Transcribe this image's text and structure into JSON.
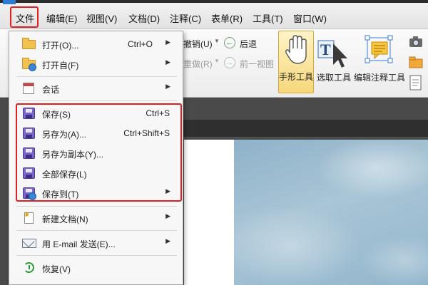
{
  "menubar": {
    "items": [
      "文件",
      "编辑(E)",
      "视图(V)",
      "文档(D)",
      "注释(C)",
      "表单(R)",
      "工具(T)",
      "窗口(W)"
    ]
  },
  "toolbar": {
    "undo": "撤销(U)",
    "back": "后退",
    "redo": "重做(R)",
    "prev_view": "前一视图",
    "hand_tool": "手形工具",
    "select_tool": "选取工具",
    "edit_annot_tool": "编辑注释工具"
  },
  "file_menu": {
    "open": {
      "label": "打开(O)...",
      "shortcut": "Ctrl+O"
    },
    "open_from": {
      "label": "打开自(F)"
    },
    "session": {
      "label": "会话"
    },
    "save": {
      "label": "保存(S)",
      "shortcut": "Ctrl+S"
    },
    "save_as": {
      "label": "另存为(A)...",
      "shortcut": "Ctrl+Shift+S"
    },
    "save_copy": {
      "label": "另存为副本(Y)..."
    },
    "save_all": {
      "label": "全部保存(L)"
    },
    "save_to": {
      "label": "保存到(T)"
    },
    "new_doc": {
      "label": "新建文档(N)"
    },
    "email": {
      "label": "用 E-mail 发送(E)..."
    },
    "restore": {
      "label": "恢复(V)"
    }
  },
  "colors": {
    "highlight_box": "#e02020",
    "save_icon": "#7b68c8",
    "folder_icon": "#f2c14e"
  }
}
